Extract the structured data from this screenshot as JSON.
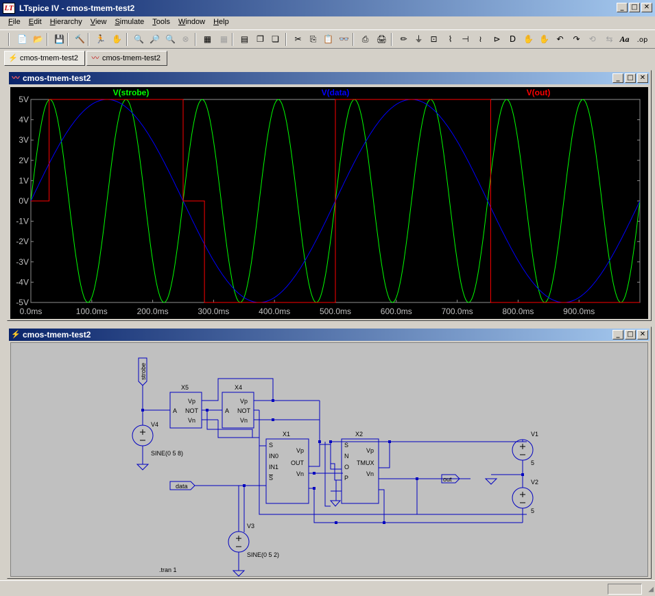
{
  "app": {
    "title": "LTspice IV - cmos-tmem-test2",
    "icon_label": "LT"
  },
  "menu": [
    {
      "label": "File",
      "accel": "F"
    },
    {
      "label": "Edit",
      "accel": "E"
    },
    {
      "label": "Hierarchy",
      "accel": "H"
    },
    {
      "label": "View",
      "accel": "V"
    },
    {
      "label": "Simulate",
      "accel": "S"
    },
    {
      "label": "Tools",
      "accel": "T"
    },
    {
      "label": "Window",
      "accel": "W"
    },
    {
      "label": "Help",
      "accel": "H"
    }
  ],
  "toolbar": [
    {
      "name": "new-schematic",
      "glyph": "📄"
    },
    {
      "name": "open",
      "glyph": "📂"
    },
    {
      "name": "save",
      "glyph": "💾"
    },
    {
      "name": "control-panel",
      "glyph": "🔨"
    },
    {
      "name": "run",
      "glyph": "🏃"
    },
    {
      "name": "pan",
      "glyph": "✋"
    },
    {
      "name": "zoom-in",
      "glyph": "🔍"
    },
    {
      "name": "zoom-area",
      "glyph": "🔎"
    },
    {
      "name": "zoom-out",
      "glyph": "🔍"
    },
    {
      "name": "zoom-fit",
      "glyph": "⊗"
    },
    {
      "name": "autorange",
      "glyph": "▦"
    },
    {
      "name": "grid",
      "glyph": "▦"
    },
    {
      "name": "tile-horizontal",
      "glyph": "▤"
    },
    {
      "name": "cascade",
      "glyph": "❐"
    },
    {
      "name": "tile-vertical",
      "glyph": "❏"
    },
    {
      "name": "cut",
      "glyph": "✂"
    },
    {
      "name": "copy",
      "glyph": "⎘"
    },
    {
      "name": "paste",
      "glyph": "📋"
    },
    {
      "name": "find",
      "glyph": "👓"
    },
    {
      "name": "print-preview",
      "glyph": "⎙"
    },
    {
      "name": "print",
      "glyph": "🖨"
    },
    {
      "name": "draw-wire",
      "glyph": "✏"
    },
    {
      "name": "ground",
      "glyph": "⏚"
    },
    {
      "name": "label-net",
      "glyph": "⊡"
    },
    {
      "name": "resistor",
      "glyph": "⌇"
    },
    {
      "name": "capacitor",
      "glyph": "⊣"
    },
    {
      "name": "inductor",
      "glyph": "≀"
    },
    {
      "name": "diode",
      "glyph": "⊳"
    },
    {
      "name": "component",
      "glyph": "D"
    },
    {
      "name": "move",
      "glyph": "✋"
    },
    {
      "name": "drag",
      "glyph": "✋"
    },
    {
      "name": "undo",
      "glyph": "↶"
    },
    {
      "name": "redo",
      "glyph": "↷"
    },
    {
      "name": "rotate",
      "glyph": "⟲"
    },
    {
      "name": "mirror",
      "glyph": "⇆"
    },
    {
      "name": "text",
      "glyph": "Aa"
    },
    {
      "name": "spice-directive",
      "glyph": ".op"
    }
  ],
  "tabs": [
    {
      "label": "cmos-tmem-test2",
      "icon": "schematic-icon"
    },
    {
      "label": "cmos-tmem-test2",
      "icon": "waveform-icon"
    }
  ],
  "waveform_window": {
    "title": "cmos-tmem-test2",
    "traces": [
      {
        "label": "V(strobe)",
        "color": "#00ff00"
      },
      {
        "label": "V(data)",
        "color": "#0000ff"
      },
      {
        "label": "V(out)",
        "color": "#ff0000"
      }
    ]
  },
  "schematic_window": {
    "title": "cmos-tmem-test2",
    "labels": {
      "x5": "X5",
      "x4": "X4",
      "x1": "X1",
      "x2": "X2",
      "v1": "V1",
      "v2": "V2",
      "v3": "V3",
      "v4": "V4",
      "vp": "Vp",
      "not": "NOT",
      "a": "A",
      "vn": "Vn",
      "s": "S",
      "in0": "IN0",
      "in1": "IN1",
      "sbar": "S",
      "out": "OUT",
      "n": "N",
      "o": "O",
      "p": "P",
      "tmux": "TMUX",
      "v4_value": "SINE(0 5 8)",
      "v3_value": "SINE(0 5 2)",
      "v1_value": "5",
      "v2_value": "5",
      "net_strobe": "strobe",
      "net_data": "data",
      "net_out": "out",
      "directive": ".tran 1"
    }
  },
  "chart_data": {
    "type": "line",
    "title": "",
    "xlabel": "",
    "ylabel": "",
    "xlim": [
      0,
      1000
    ],
    "ylim": [
      -5,
      5
    ],
    "x_unit": "ms",
    "x_ticks": [
      "0.0ms",
      "100.0ms",
      "200.0ms",
      "300.0ms",
      "400.0ms",
      "500.0ms",
      "600.0ms",
      "700.0ms",
      "800.0ms",
      "900.0ms"
    ],
    "y_ticks": [
      "5V",
      "4V",
      "3V",
      "2V",
      "1V",
      "0V",
      "-1V",
      "-2V",
      "-3V",
      "-4V",
      "-5V"
    ],
    "grid": false,
    "legend": "top",
    "series": [
      {
        "name": "V(strobe)",
        "kind": "sine",
        "amplitude": 5,
        "frequency_hz": 8,
        "offset": 0
      },
      {
        "name": "V(data)",
        "kind": "sine",
        "amplitude": 5,
        "frequency_hz": 2,
        "offset": 0
      },
      {
        "name": "V(out)",
        "kind": "sample-hold",
        "x": [
          0,
          30,
          30,
          250,
          250,
          285,
          285,
          500,
          500,
          755,
          755,
          1000
        ],
        "values": [
          0,
          0,
          5,
          5,
          0,
          0,
          -5,
          -5,
          5,
          5,
          -5,
          -5
        ]
      }
    ]
  }
}
